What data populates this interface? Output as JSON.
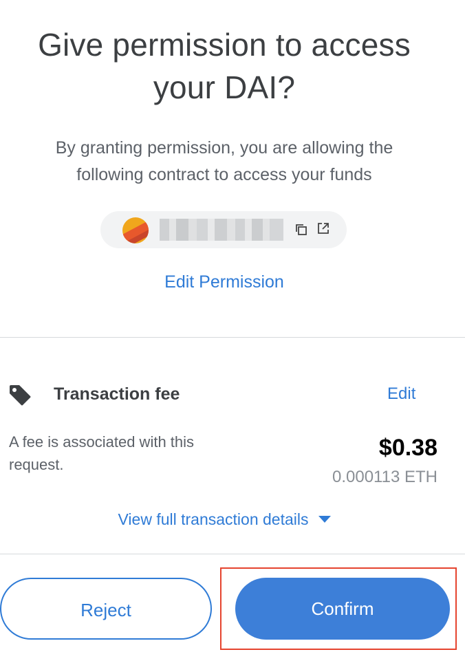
{
  "header": {
    "title_line1": "Give permission to access",
    "title_line2": "your DAI?",
    "subtitle_line1": "By granting permission, you are allowing the",
    "subtitle_line2": "following contract to access your funds"
  },
  "contract": {
    "avatar_icon": "identicon-avatar",
    "address_obscured": true,
    "copy_icon": "copy-icon",
    "open_icon": "external-link-icon"
  },
  "permission": {
    "edit_label": "Edit Permission"
  },
  "fee": {
    "icon": "tag-icon",
    "label": "Transaction fee",
    "edit_label": "Edit",
    "description_line1": "A fee is associated with this",
    "description_line2": "request.",
    "usd": "$0.38",
    "eth": "0.000113 ETH"
  },
  "details": {
    "link_label": "View full transaction details"
  },
  "actions": {
    "reject_label": "Reject",
    "confirm_label": "Confirm"
  },
  "colors": {
    "accent": "#2f7bd6",
    "confirm_bg": "#3d7fd8",
    "highlight": "#e5432e",
    "divider": "#d6d9dc"
  }
}
